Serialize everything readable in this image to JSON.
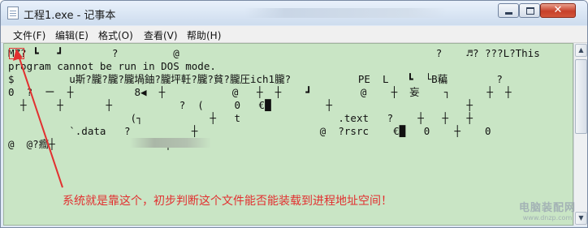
{
  "window": {
    "title": "工程1.exe - 记事本",
    "app_icon": "notepad-icon",
    "controls": {
      "minimize": "minimize-icon",
      "maximize": "maximize-icon",
      "close_glyph": "✕"
    }
  },
  "menu": {
    "items": [
      {
        "label": "文件(F)"
      },
      {
        "label": "编辑(E)"
      },
      {
        "label": "格式(O)"
      },
      {
        "label": "查看(V)"
      },
      {
        "label": "帮助(H)"
      }
    ]
  },
  "editor": {
    "background": "#c9e5c5",
    "lines": [
      "MZ? ┗   ┛        ?         @                                          ?    ♬? ???L?This",
      "program cannot be run in DOS mode.",
      "$         u斯?朧?朧?朧堝鈾?朧坪軠?朧?貧?朧圧ich1朧?           PE  L   ┗  └B藊        ?",
      "0  ?  ー  ┼          8◀  ┼           @   ┼  ┼    ┛        @    ┼  妄    ┐      ┼  ┼",
      "  ┼     ┼       ┼           ?  (     0   €█         ┼                      ┼",
      "                    (┐           ┼   t                .text   ?    ┼   ┼   ┼",
      "          `.data   ?          ┼                    @  ?rsrc    €█   0    ┼    0",
      "@  @?癎┼                  ┼"
    ]
  },
  "annotation": {
    "text": "系统就是靠这个，初步判断这个文件能否能装载到进程地址空间！",
    "color": "#e23030"
  },
  "watermark": {
    "line1": "电脑装配网",
    "line2": "www.dnzp.com"
  }
}
